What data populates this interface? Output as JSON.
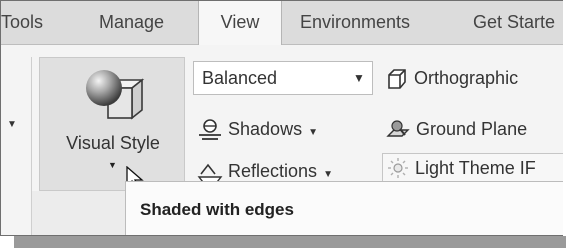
{
  "tabs": [
    {
      "label": "Tools",
      "active": false
    },
    {
      "label": "Manage",
      "active": false
    },
    {
      "label": "View",
      "active": true
    },
    {
      "label": "Environments",
      "active": false
    },
    {
      "label": "Get Starte",
      "active": false
    }
  ],
  "visual_style": {
    "label": "Visual Style",
    "icon": "sphere-cube-icon"
  },
  "style_dropdown": {
    "value": "Balanced"
  },
  "orthographic": {
    "label": "Orthographic",
    "icon": "orthographic-cube-icon"
  },
  "shadows": {
    "label": "Shadows",
    "icon": "shadows-icon"
  },
  "ground_plane": {
    "label": "Ground Plane",
    "icon": "ground-plane-icon"
  },
  "reflections": {
    "label": "Reflections",
    "icon": "reflections-icon"
  },
  "lighting": {
    "label": "Light Theme IF",
    "icon": "light-theme-icon"
  },
  "tooltip": {
    "text": "Shaded with edges"
  }
}
